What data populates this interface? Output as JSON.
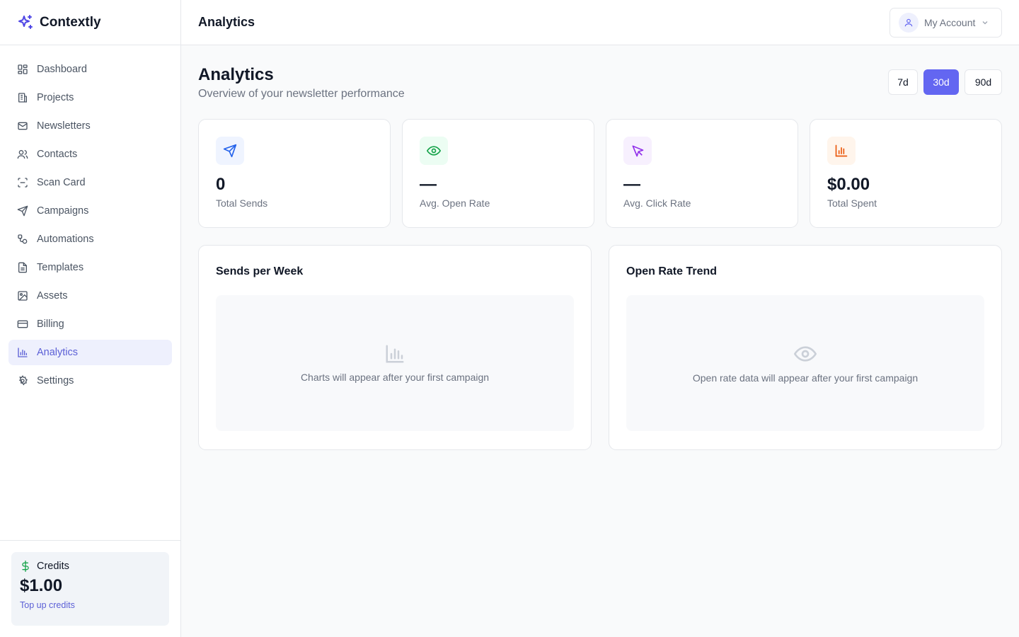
{
  "brand": {
    "name": "Contextly"
  },
  "sidebar": {
    "items": [
      {
        "label": "Dashboard",
        "icon": "dashboard-icon"
      },
      {
        "label": "Projects",
        "icon": "building-icon"
      },
      {
        "label": "Newsletters",
        "icon": "mail-icon"
      },
      {
        "label": "Contacts",
        "icon": "users-icon"
      },
      {
        "label": "Scan Card",
        "icon": "scan-icon"
      },
      {
        "label": "Campaigns",
        "icon": "send-icon"
      },
      {
        "label": "Automations",
        "icon": "workflow-icon"
      },
      {
        "label": "Templates",
        "icon": "file-icon"
      },
      {
        "label": "Assets",
        "icon": "image-icon"
      },
      {
        "label": "Billing",
        "icon": "credit-card-icon"
      },
      {
        "label": "Analytics",
        "icon": "bar-chart-icon",
        "active": true
      },
      {
        "label": "Settings",
        "icon": "gear-icon"
      }
    ],
    "credits": {
      "label": "Credits",
      "amount": "$1.00",
      "link": "Top up credits"
    }
  },
  "header": {
    "title": "Analytics",
    "account_label": "My Account"
  },
  "page": {
    "title": "Analytics",
    "subtitle": "Overview of your newsletter performance",
    "ranges": [
      "7d",
      "30d",
      "90d"
    ],
    "active_range": "30d"
  },
  "stats": [
    {
      "value": "0",
      "label": "Total Sends",
      "icon": "send-icon",
      "color": "#2563eb",
      "bg": "#eff4ff"
    },
    {
      "value": "—",
      "label": "Avg. Open Rate",
      "icon": "eye-icon",
      "color": "#16a34a",
      "bg": "#ecfdf3"
    },
    {
      "value": "—",
      "label": "Avg. Click Rate",
      "icon": "cursor-icon",
      "color": "#9333ea",
      "bg": "#f7f0fe"
    },
    {
      "value": "$0.00",
      "label": "Total Spent",
      "icon": "bar-chart-icon",
      "color": "#ea580c",
      "bg": "#fff5ec"
    }
  ],
  "charts": [
    {
      "title": "Sends per Week",
      "empty_text": "Charts will appear after your first campaign",
      "icon": "bar-chart-icon"
    },
    {
      "title": "Open Rate Trend",
      "empty_text": "Open rate data will appear after your first campaign",
      "icon": "eye-icon"
    }
  ],
  "colors": {
    "accent": "#6366f1",
    "accent_text": "#5b5fd6"
  }
}
